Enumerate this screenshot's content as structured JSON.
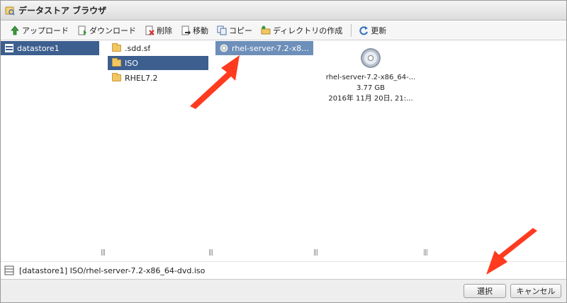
{
  "window": {
    "title": "データストア ブラウザ"
  },
  "toolbar": {
    "upload": "アップロード",
    "download": "ダウンロード",
    "delete": "削除",
    "move": "移動",
    "copy": "コピー",
    "mkdir": "ディレクトリの作成",
    "refresh": "更新"
  },
  "columns": {
    "datastores": [
      {
        "label": "datastore1"
      }
    ],
    "folders": [
      {
        "label": ".sdd.sf"
      },
      {
        "label": "ISO"
      },
      {
        "label": "RHEL7.2"
      }
    ],
    "files": [
      {
        "label": "rhel-server-7.2-x86..."
      }
    ]
  },
  "preview": {
    "name": "rhel-server-7.2-x86_64-...",
    "size": "3.77 GB",
    "modified": "2016年 11月 20日, 21:..."
  },
  "pathbar": {
    "path": "[datastore1] ISO/rhel-server-7.2-x86_64-dvd.iso"
  },
  "footer": {
    "select": "選択",
    "cancel": "キャンセル"
  },
  "colors": {
    "selection": "#3d5f8f",
    "selection_secondary": "#6d8fb9",
    "arrow": "#ff3b1f"
  }
}
